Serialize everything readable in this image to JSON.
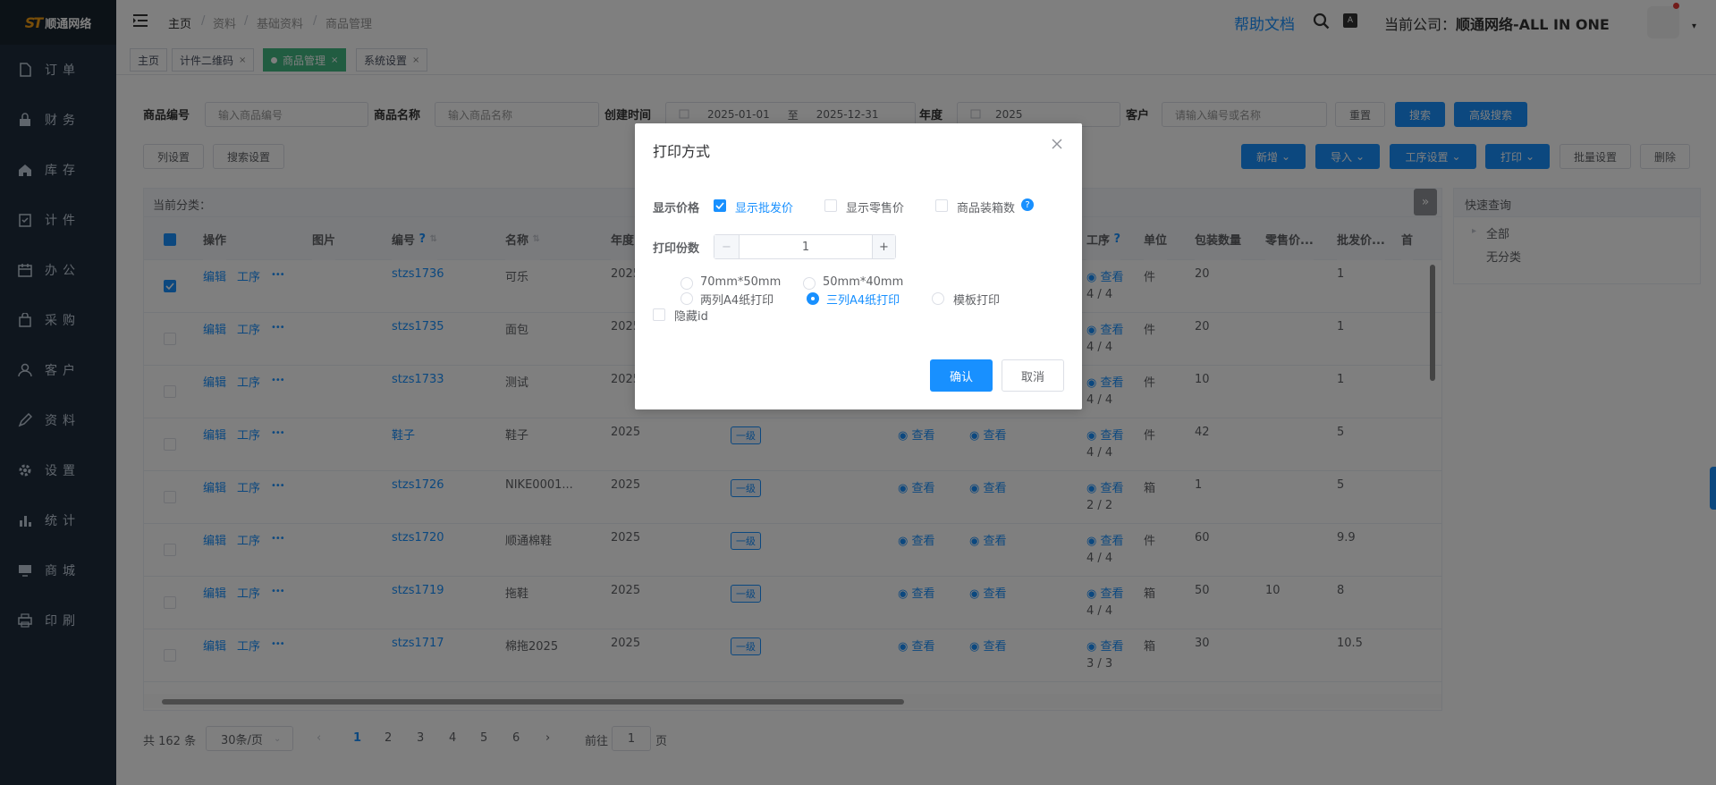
{
  "app": {
    "logo_mark": "ST",
    "logo_text": "顺通网络"
  },
  "sidebar": {
    "items": [
      {
        "label": "订单",
        "icon": "file-icon"
      },
      {
        "label": "财务",
        "icon": "lock-icon"
      },
      {
        "label": "库存",
        "icon": "home-icon"
      },
      {
        "label": "计件",
        "icon": "clipboard-icon"
      },
      {
        "label": "办公",
        "icon": "calendar-icon"
      },
      {
        "label": "采购",
        "icon": "bag-icon"
      },
      {
        "label": "客户",
        "icon": "user-icon"
      },
      {
        "label": "资料",
        "icon": "pen-icon"
      },
      {
        "label": "设置",
        "icon": "gear-icon"
      },
      {
        "label": "统计",
        "icon": "bar-chart-icon"
      },
      {
        "label": "商城",
        "icon": "monitor-icon"
      },
      {
        "label": "印刷",
        "icon": "printer-icon"
      }
    ]
  },
  "header": {
    "breadcrumb": [
      "主页",
      "资料",
      "基础资料",
      "商品管理"
    ],
    "help": "帮助文档",
    "company_label": "当前公司：",
    "company_name": "顺通网络-ALL IN ONE"
  },
  "tags": [
    {
      "label": "主页"
    },
    {
      "label": "计件二维码",
      "close": "×"
    },
    {
      "label": "商品管理",
      "close": "×"
    },
    {
      "label": "系统设置",
      "close": "×"
    }
  ],
  "filters": {
    "code_label": "商品编号",
    "code_placeholder": "输入商品编号",
    "name_label": "商品名称",
    "name_placeholder": "输入商品名称",
    "time_label": "创建时间",
    "date_from": "2025-01-01",
    "date_sep": "至",
    "date_to": "2025-12-31",
    "year_label": "年度",
    "year_value": "2025",
    "customer_label": "客户",
    "customer_placeholder": "请输入编号或名称",
    "reset": "重置",
    "search": "搜索",
    "advanced": "高级搜索"
  },
  "toolbar": {
    "columns": "列设置",
    "search_settings": "搜索设置",
    "add": "新增",
    "import": "导入",
    "process": "工序设置",
    "print": "打印",
    "batch": "批量设置",
    "delete": "删除"
  },
  "table": {
    "category_label": "当前分类：",
    "headers": [
      "操作",
      "图片",
      "编号",
      "名称",
      "年度",
      "工序",
      "单位",
      "包装数量",
      "零售价...",
      "批发价...",
      "首"
    ],
    "action_edit": "编辑",
    "action_process": "工序",
    "action_more": "•••",
    "view_label": "查看",
    "rows": [
      {
        "code": "stzs1736",
        "name": "可乐",
        "year": "2025",
        "level": "",
        "progress": "4 / 4",
        "unit": "件",
        "pack": "20",
        "retail": "",
        "wholesale": "1",
        "checked": true
      },
      {
        "code": "stzs1735",
        "name": "面包",
        "year": "2025",
        "level": "",
        "progress": "4 / 4",
        "unit": "件",
        "pack": "20",
        "retail": "",
        "wholesale": "1",
        "checked": false
      },
      {
        "code": "stzs1733",
        "name": "测试",
        "year": "2025",
        "level": "",
        "progress": "4 / 4",
        "unit": "件",
        "pack": "10",
        "retail": "",
        "wholesale": "1",
        "checked": false
      },
      {
        "code": "鞋子",
        "name": "鞋子",
        "year": "2025",
        "level": "一级",
        "progress": "4 / 4",
        "unit": "件",
        "pack": "42",
        "retail": "",
        "wholesale": "5",
        "checked": false
      },
      {
        "code": "stzs1726",
        "name": "NIKE0001...",
        "year": "2025",
        "level": "一级",
        "progress": "2 / 2",
        "unit": "箱",
        "pack": "1",
        "retail": "",
        "wholesale": "5",
        "checked": false
      },
      {
        "code": "stzs1720",
        "name": "顺通棉鞋",
        "year": "2025",
        "level": "一级",
        "progress": "4 / 4",
        "unit": "件",
        "pack": "60",
        "retail": "",
        "wholesale": "9.9",
        "checked": false
      },
      {
        "code": "stzs1719",
        "name": "拖鞋",
        "year": "2025",
        "level": "一级",
        "progress": "4 / 4",
        "unit": "箱",
        "pack": "50",
        "retail": "10",
        "wholesale": "8",
        "checked": false
      },
      {
        "code": "stzs1717",
        "name": "棉拖2025",
        "year": "2025",
        "level": "一级",
        "progress": "3 / 3",
        "unit": "箱",
        "pack": "30",
        "retail": "",
        "wholesale": "10.5",
        "checked": false
      }
    ]
  },
  "quick": {
    "title": "快速查询",
    "all": "全部",
    "none": "无分类"
  },
  "pager": {
    "total": "共 162 条",
    "size": "30条/页",
    "pages": [
      "1",
      "2",
      "3",
      "4",
      "5",
      "6"
    ],
    "goto_label": "前往",
    "goto_value": "1",
    "goto_unit": "页"
  },
  "dialog": {
    "title": "打印方式",
    "price_label": "显示价格",
    "show_wholesale": "显示批发价",
    "show_retail": "显示零售价",
    "show_box": "商品装箱数",
    "copies_label": "打印份数",
    "copies_value": "1",
    "minus": "−",
    "plus": "+",
    "opt_70": "70mm*50mm",
    "opt_50": "50mm*40mm",
    "opt_a4_2": "两列A4纸打印",
    "opt_a4_3": "三列A4纸打印",
    "opt_template": "模板打印",
    "hide_id": "隐藏id",
    "confirm": "确认",
    "cancel": "取消"
  },
  "colors": {
    "primary": "#1890ff",
    "sidebar": "#1f2d3d",
    "tag_active": "#42b983"
  }
}
